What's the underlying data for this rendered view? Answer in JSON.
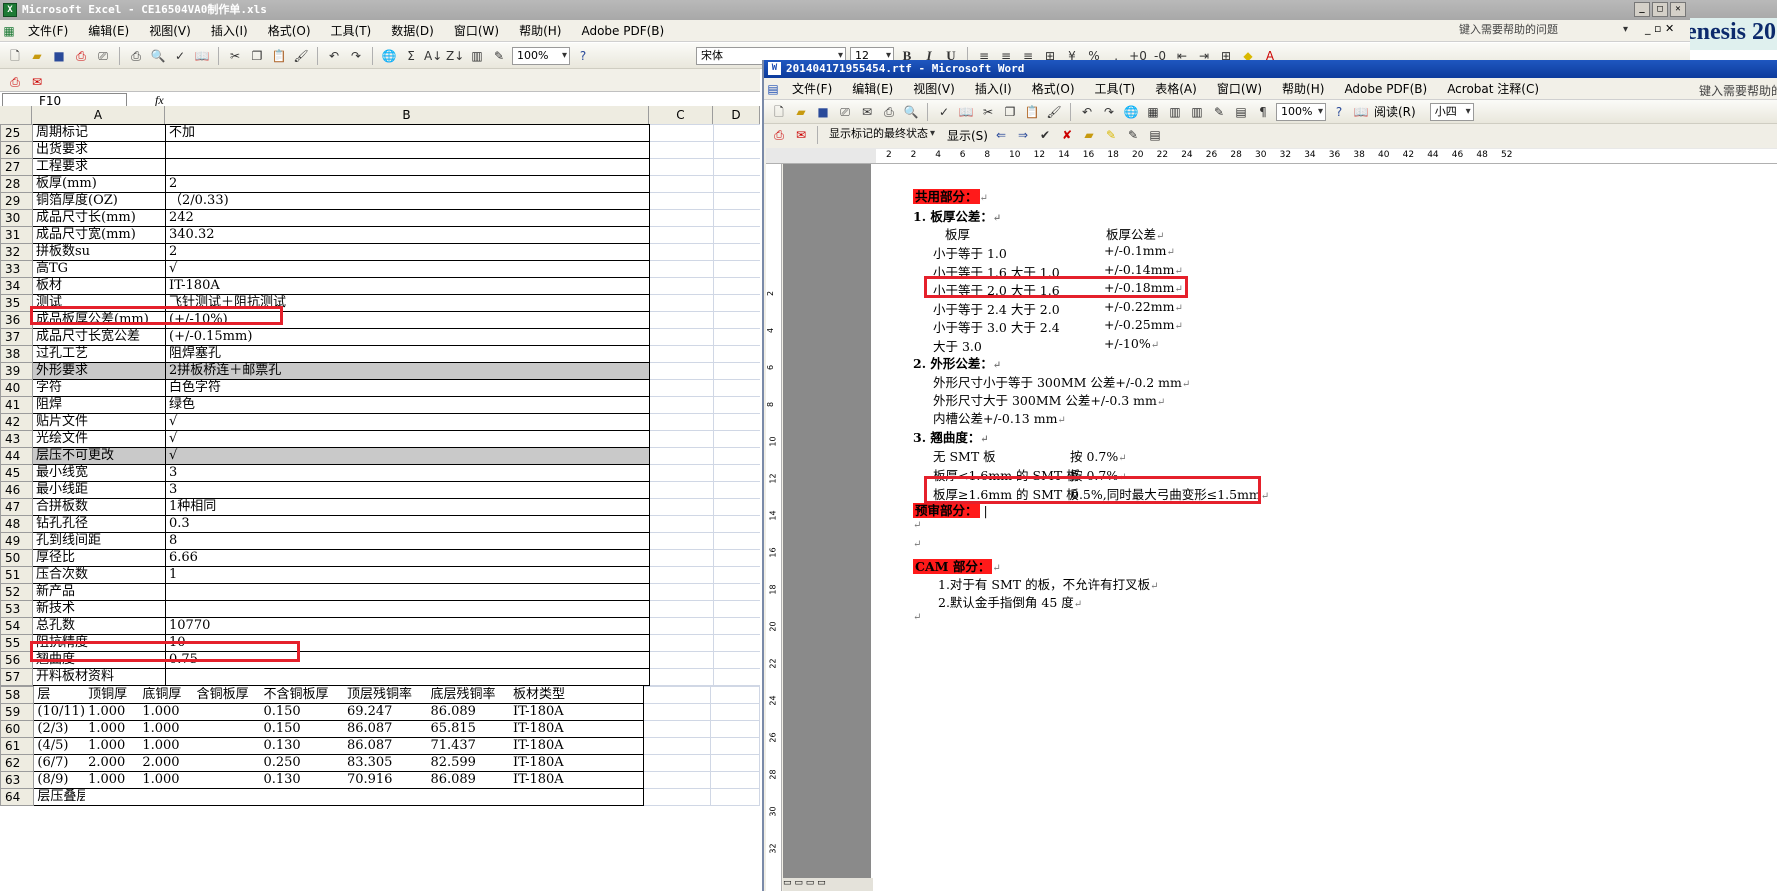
{
  "excel": {
    "title": "Microsoft Excel - CE16504VA0制作单.xls",
    "menu": [
      "文件(F)",
      "编辑(E)",
      "视图(V)",
      "插入(I)",
      "格式(O)",
      "工具(T)",
      "数据(D)",
      "窗口(W)",
      "帮助(H)",
      "Adobe PDF(B)"
    ],
    "help_box": "键入需要帮助的问题",
    "zoom": "100%",
    "font_name": "宋体",
    "font_size": "12",
    "name_box": "F10",
    "fx": "fx",
    "col_headers": [
      "A",
      "B",
      "C",
      "D"
    ],
    "rows": [
      {
        "n": "25",
        "a": "周期标记",
        "b": "不加"
      },
      {
        "n": "26",
        "a": "出货要求",
        "b": ""
      },
      {
        "n": "27",
        "a": "工程要求",
        "b": ""
      },
      {
        "n": "28",
        "a": "板厚(mm)",
        "b": "2"
      },
      {
        "n": "29",
        "a": "铜箔厚度(OZ)",
        "b": "（2/0.33)"
      },
      {
        "n": "30",
        "a": "成品尺寸长(mm)",
        "b": "242"
      },
      {
        "n": "31",
        "a": "成品尺寸宽(mm)",
        "b": "340.32"
      },
      {
        "n": "32",
        "a": "拼板数su",
        "b": "2"
      },
      {
        "n": "33",
        "a": "高TG",
        "b": "√"
      },
      {
        "n": "34",
        "a": "板材",
        "b": "IT-180A"
      },
      {
        "n": "35",
        "a": "测试",
        "b": "飞针测试＋阻抗测试"
      },
      {
        "n": "36",
        "a": "成品板厚公差(mm)",
        "b": "(+/-10%)"
      },
      {
        "n": "37",
        "a": "成品尺寸长宽公差",
        "b": "(+/-0.15mm)"
      },
      {
        "n": "38",
        "a": "过孔工艺",
        "b": "阻焊塞孔"
      },
      {
        "n": "39",
        "a": "外形要求",
        "b": "2拼板桥连＋邮票孔",
        "gray": true
      },
      {
        "n": "40",
        "a": "字符",
        "b": "白色字符"
      },
      {
        "n": "41",
        "a": "阻焊",
        "b": "绿色"
      },
      {
        "n": "42",
        "a": "贴片文件",
        "b": "√"
      },
      {
        "n": "43",
        "a": "光绘文件",
        "b": "√"
      },
      {
        "n": "44",
        "a": "层压不可更改",
        "b": "√",
        "gray": true
      },
      {
        "n": "45",
        "a": "最小线宽",
        "b": "3"
      },
      {
        "n": "46",
        "a": "最小线距",
        "b": "3"
      },
      {
        "n": "47",
        "a": "合拼板数",
        "b": "1种相同"
      },
      {
        "n": "48",
        "a": "钻孔孔径",
        "b": "0.3"
      },
      {
        "n": "49",
        "a": "孔到线间距",
        "b": "8"
      },
      {
        "n": "50",
        "a": "厚径比",
        "b": "6.66"
      },
      {
        "n": "51",
        "a": "压合次数",
        "b": "1"
      },
      {
        "n": "52",
        "a": "新产品",
        "b": ""
      },
      {
        "n": "53",
        "a": "新技术",
        "b": ""
      },
      {
        "n": "54",
        "a": "总孔数",
        "b": "10770"
      },
      {
        "n": "55",
        "a": "阻抗精度",
        "b": "10"
      },
      {
        "n": "56",
        "a": "翘曲度",
        "b": "0.75"
      },
      {
        "n": "57",
        "a": "开料板材资料",
        "b": ""
      }
    ],
    "layer_header": {
      "n": "58",
      "cols": [
        "层",
        "顶铜厚",
        "底铜厚",
        "含铜板厚",
        "不含铜板厚",
        "顶层残铜率",
        "底层残铜率",
        "板材类型"
      ]
    },
    "layer_rows": [
      {
        "n": "59",
        "cols": [
          "(10/11)",
          "1.000",
          "1.000",
          "",
          "0.150",
          "69.247",
          "86.089",
          "IT-180A"
        ]
      },
      {
        "n": "60",
        "cols": [
          "(2/3)",
          "1.000",
          "1.000",
          "",
          "0.150",
          "86.087",
          "65.815",
          "IT-180A"
        ]
      },
      {
        "n": "61",
        "cols": [
          "(4/5)",
          "1.000",
          "1.000",
          "",
          "0.130",
          "86.087",
          "71.437",
          "IT-180A"
        ]
      },
      {
        "n": "62",
        "cols": [
          "(6/7)",
          "2.000",
          "2.000",
          "",
          "0.250",
          "83.305",
          "82.599",
          "IT-180A"
        ]
      },
      {
        "n": "63",
        "cols": [
          "(8/9)",
          "1.000",
          "1.000",
          "",
          "0.130",
          "70.916",
          "86.089",
          "IT-180A"
        ]
      },
      {
        "n": "64",
        "cols": [
          "层压叠层结构",
          "",
          "",
          "",
          "",
          "",
          "",
          ""
        ]
      }
    ]
  },
  "word": {
    "title": "201404171955454.rtf - Microsoft Word",
    "menu": [
      "文件(F)",
      "编辑(E)",
      "视图(V)",
      "插入(I)",
      "格式(O)",
      "工具(T)",
      "表格(A)",
      "窗口(W)",
      "帮助(H)",
      "Adobe PDF(B)",
      "Acrobat 注释(C)"
    ],
    "help_box": "键入需要帮助的问题",
    "zoom": "100%",
    "read_btn": "阅读(R)",
    "font_size": "小四",
    "review_combo": "显示标记的最终状态",
    "show_btn": "显示(S)",
    "ruler_h": [
      "2",
      "2",
      "4",
      "6",
      "8",
      "10",
      "12",
      "14",
      "16",
      "18",
      "20",
      "22",
      "24",
      "26",
      "28",
      "30",
      "32",
      "34",
      "36",
      "38",
      "40",
      "42",
      "44",
      "46",
      "48",
      "52"
    ],
    "ruler_v": [
      "2",
      "4",
      "6",
      "8",
      "10",
      "12",
      "14",
      "16",
      "18",
      "20",
      "22",
      "24",
      "26",
      "28",
      "30",
      "32"
    ],
    "doc": {
      "sec_common": "共用部分：",
      "item1": "1.  板厚公差：",
      "t_head_a": "板厚",
      "t_head_b": "板厚公差",
      "t_rows": [
        {
          "a": "小于等于 1.0",
          "b": "+/-0.1mm"
        },
        {
          "a": "小于等于 1.6 大于 1.0",
          "b": "+/-0.14mm"
        },
        {
          "a": "小于等于 2.0 大于 1.6",
          "b": "+/-0.18mm"
        },
        {
          "a": "小于等于 2.4 大于 2.0",
          "b": "+/-0.22mm"
        },
        {
          "a": "小于等于 3.0 大于 2.4",
          "b": "+/-0.25mm"
        },
        {
          "a": "大于 3.0",
          "b": "+/-10%"
        }
      ],
      "item2": "2.  外形公差：",
      "shape": [
        "外形尺寸小于等于 300MM  公差+/-0.2  mm",
        "外形尺寸大于 300MM      公差+/-0.3  mm",
        "内槽公差+/-0.13  mm"
      ],
      "item3": "3.  翘曲度：",
      "warp": [
        {
          "a": "无 SMT 板",
          "b": "按 0.7%"
        },
        {
          "a": "板厚<1.6mm 的 SMT 板",
          "b": "按 0.7%"
        },
        {
          "a": "板厚≥1.6mm 的 SMT 板",
          "b": "0.5%,同时最大弓曲变形≤1.5mm"
        }
      ],
      "sec_pre": "预审部分：",
      "sec_cam": "CAM 部分：",
      "cam": [
        "1.对于有 SMT 的板，不允许有打叉板",
        "2.默认金手指倒角 45 度"
      ],
      "para_mark": "↵"
    }
  },
  "background_text": "enesis 20",
  "colors": {
    "highlight": "#ff1a1a",
    "box": "#e5202b",
    "title": "#a9a9a9"
  }
}
